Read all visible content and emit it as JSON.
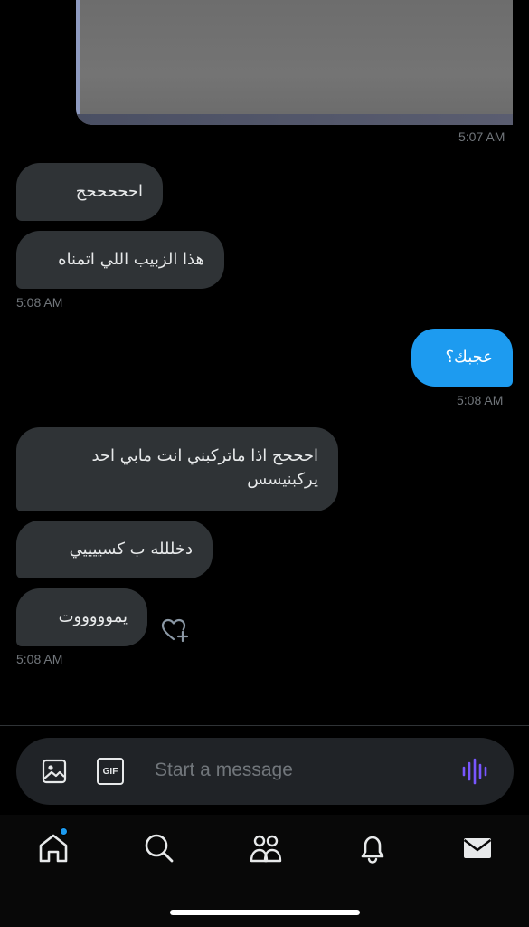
{
  "conversation": {
    "messages": [
      {
        "text": "احححححح"
      },
      {
        "text": "هذا الزبيب اللي اتمناه"
      },
      {
        "text": "عجبك؟"
      },
      {
        "line1": "احححح اذا ماتركبني انت مابي احد",
        "line2": "يركبنيسس"
      },
      {
        "text": "دخللله ب كسييييي"
      },
      {
        "text": "يموووووت"
      }
    ],
    "timestamps": [
      "5:07 AM",
      "5:08 AM",
      "5:08 AM",
      "5:08 AM"
    ]
  },
  "composer": {
    "placeholder": "Start a message",
    "gif_label": "GIF"
  },
  "icons": {
    "react": "heart-add-icon",
    "image": "image-icon",
    "gif": "gif-icon",
    "voice": "voice-wave-icon",
    "tabs": [
      "home-icon",
      "search-icon",
      "communities-icon",
      "notifications-icon",
      "messages-icon"
    ]
  },
  "colors": {
    "background": "#000000",
    "incoming_bubble": "#2f3336",
    "outgoing_bubble": "#1d9bf0",
    "accent": "#1d9bf0",
    "voice_icon": "#7856ff"
  }
}
